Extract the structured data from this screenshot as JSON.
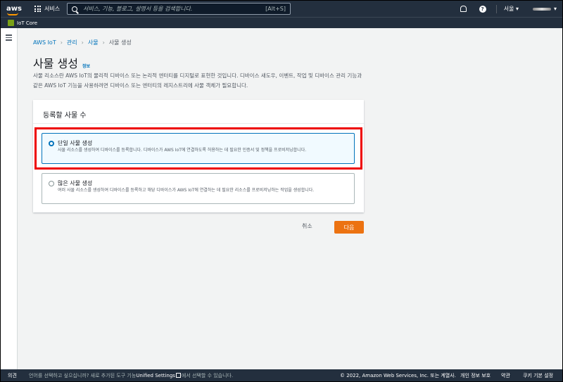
{
  "topnav": {
    "logo_text": "aws",
    "services_label": "서비스",
    "search_placeholder": "서비스, 기능, 블로그, 설명서 등을 검색합니다.",
    "search_shortcut": "[Alt+S]",
    "help_glyph": "?",
    "region": "서울 ▾",
    "account_caret": "▾"
  },
  "service_bar": {
    "label": "IoT Core"
  },
  "breadcrumb": {
    "items": [
      "AWS IoT",
      "관리",
      "사물",
      "사물 생성"
    ],
    "separator": "›"
  },
  "page": {
    "title": "사물 생성",
    "info_link": "정보",
    "description": "사물 리소스란 AWS IoT의 물리적 디바이스 또는 논리적 엔터티를 디지털로 표현한 것입니다. 디바이스 새도우, 이벤트, 작업 및 디바이스 관리 기능과 같은 AWS IoT 기능을 사용하려면 디바이스 또는 엔터티의 레지스트리에 사물 객체가 필요합니다."
  },
  "panel": {
    "heading": "등록할 사물 수",
    "options": [
      {
        "title": "단일 사물 생성",
        "desc": "사물 리소스를 생성하여 디바이스를 등록합니다. 디바이스가 AWS IoT에 연결하도록 허용하는 데 필요한 인증서 및 정책을 프로비저닝합니다.",
        "selected": true
      },
      {
        "title": "많은 사물 생성",
        "desc": "여러 사물 리소스를 생성하여 디바이스를 등록하고 해당 디바이스가 AWS IoT에 연결하는 데 필요한 리소스를 프로비저닝하는 작업을 생성합니다.",
        "selected": false
      }
    ]
  },
  "actions": {
    "cancel": "취소",
    "next": "다음"
  },
  "footer": {
    "feedback": "의견",
    "lang_prefix": "언어를 선택하고 싶으십니까? 새로 추가된 도구 기능",
    "lang_bold": "Unified Settings",
    "lang_suffix": "에서 선택할 수 있습니다.",
    "copyright": "© 2022, Amazon Web Services, Inc. 또는 계열사.",
    "privacy": "개인 정보 보호",
    "terms": "약관",
    "cookies": "쿠키 기본 설정"
  },
  "colors": {
    "nav_bg": "#232f3e",
    "primary": "#ec7211",
    "link": "#0073bb",
    "highlight": "#ee0000"
  }
}
